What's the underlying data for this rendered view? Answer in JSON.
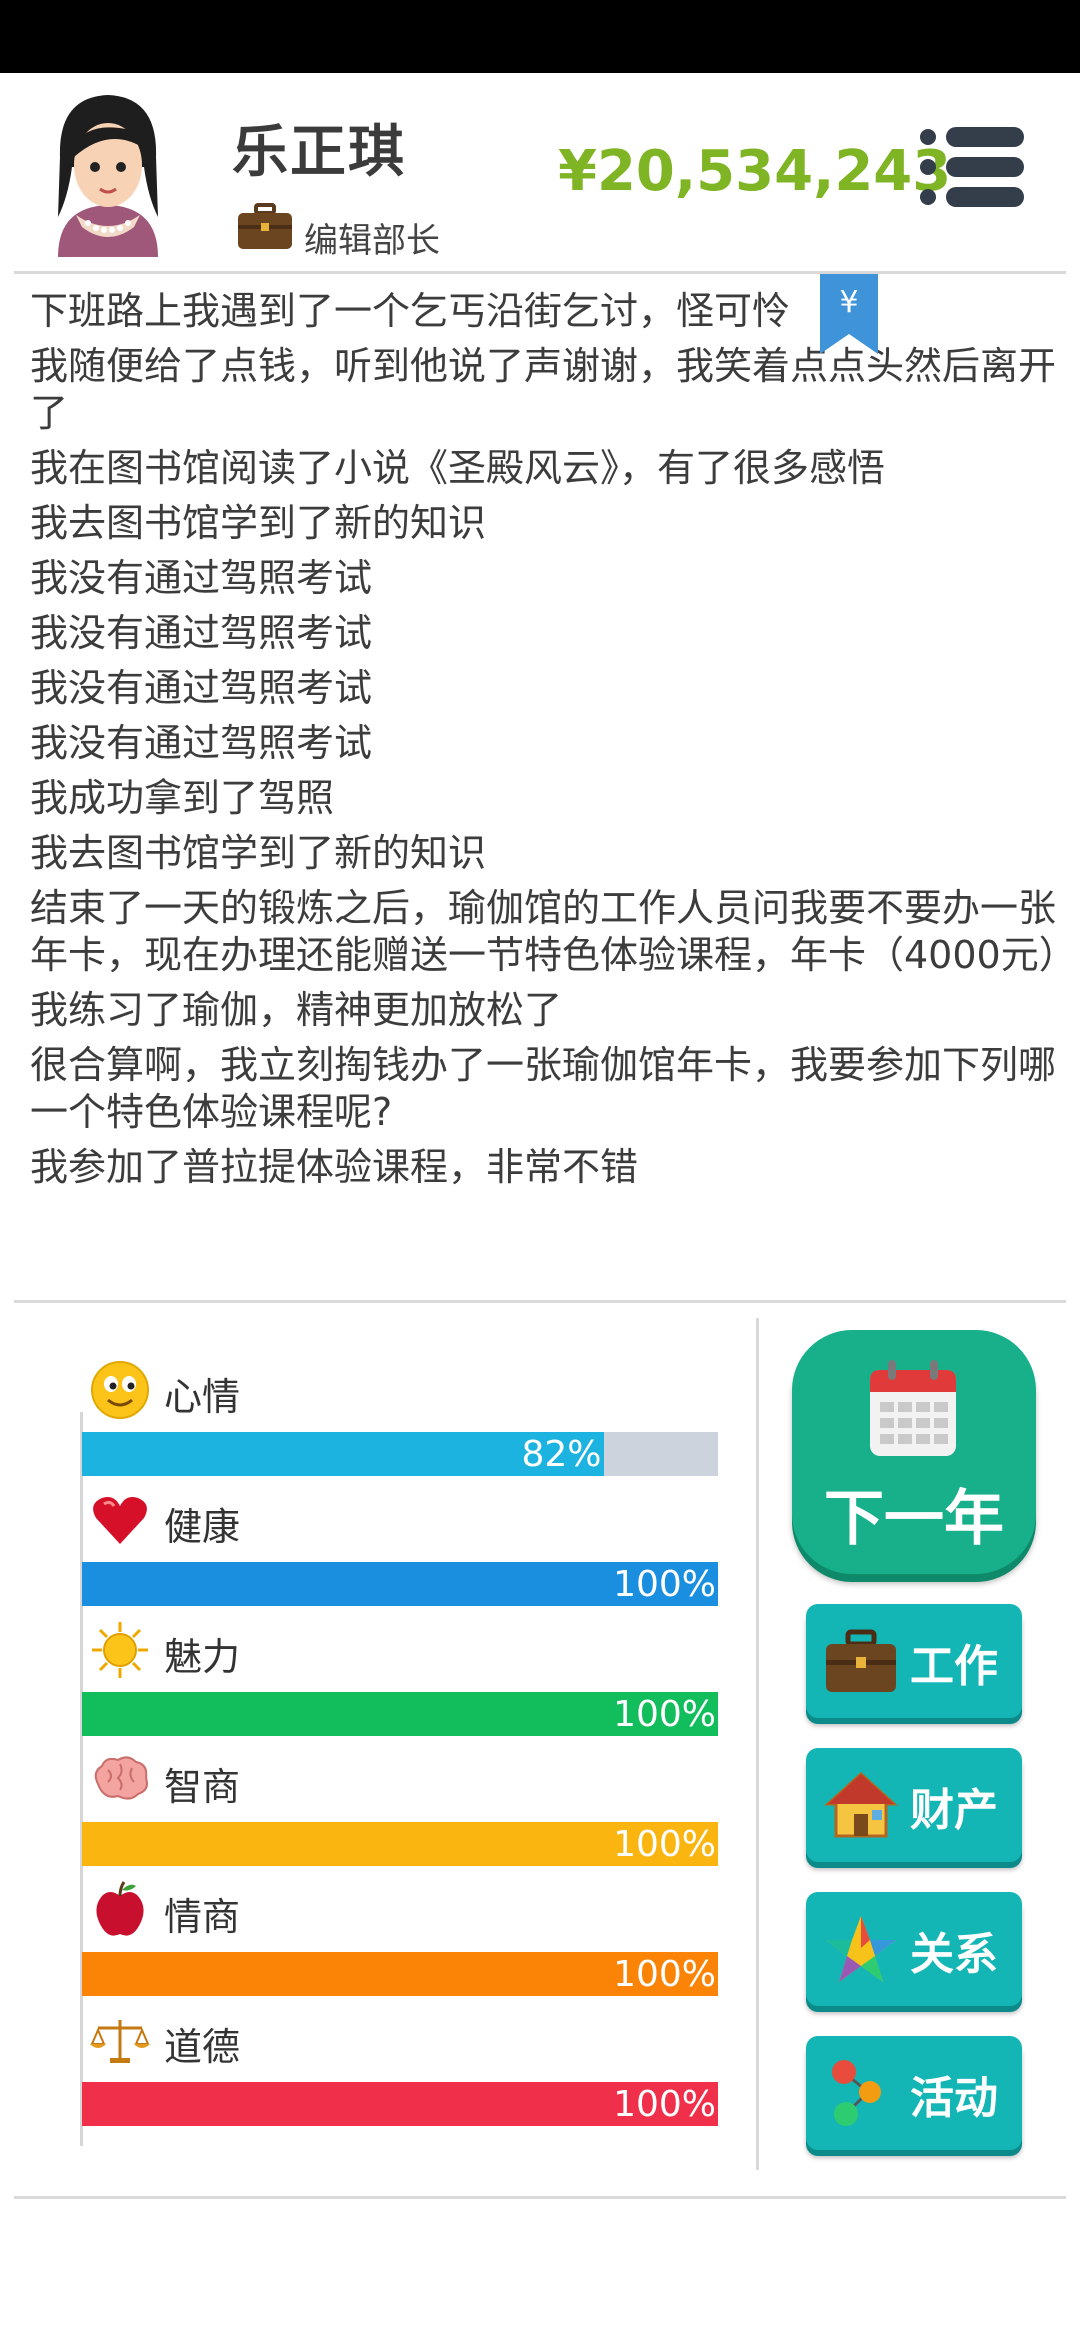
{
  "player": {
    "name": "乐正琪",
    "job": "编辑部长",
    "money": "¥20,534,243"
  },
  "log": [
    "下班路上我遇到了一个乞丐沿街乞讨，怪可怜",
    "我随便给了点钱，听到他说了声谢谢，我笑着点点头然后离开了",
    "我在图书馆阅读了小说《圣殿风云》，有了很多感悟",
    "我去图书馆学到了新的知识",
    "我没有通过驾照考试",
    "我没有通过驾照考试",
    "我没有通过驾照考试",
    "我没有通过驾照考试",
    "我成功拿到了驾照",
    "我去图书馆学到了新的知识",
    "结束了一天的锻炼之后，瑜伽馆的工作人员问我要不要办一张年卡，现在办理还能赠送一节特色体验课程，年卡（4000元）",
    "我练习了瑜伽，精神更加放松了",
    "很合算啊，我立刻掏钱办了一张瑜伽馆年卡，我要参加下列哪一个特色体验课程呢?",
    "我参加了普拉提体验课程，非常不错"
  ],
  "bookmark_symbol": "¥",
  "stats": [
    {
      "label": "心情",
      "percent_text": "82%",
      "value": 82,
      "color": "#1db3e0",
      "icon": "smiley-icon"
    },
    {
      "label": "健康",
      "percent_text": "100%",
      "value": 100,
      "color": "#1a8fe0",
      "icon": "heart-icon"
    },
    {
      "label": "魅力",
      "percent_text": "100%",
      "value": 100,
      "color": "#12bd5c",
      "icon": "sun-icon"
    },
    {
      "label": "智商",
      "percent_text": "100%",
      "value": 100,
      "color": "#fbb511",
      "icon": "brain-icon"
    },
    {
      "label": "情商",
      "percent_text": "100%",
      "value": 100,
      "color": "#fb8305",
      "icon": "apple-icon"
    },
    {
      "label": "道德",
      "percent_text": "100%",
      "value": 100,
      "color": "#f0304a",
      "icon": "scales-icon"
    }
  ],
  "actions": {
    "next_year": "下一年",
    "work": "工作",
    "property": "财产",
    "relations": "关系",
    "activities": "活动"
  }
}
